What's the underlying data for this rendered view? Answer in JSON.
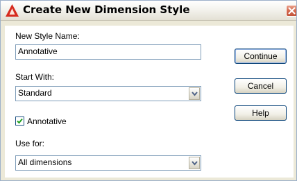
{
  "window": {
    "title": "Create New Dimension Style",
    "app_icon": "autocad-triangle-icon",
    "close_icon": "close-x-icon",
    "colors": {
      "title_icon": "#d62b1e",
      "close_button": "#d46a4f",
      "checkmark": "#21a121",
      "text": "#000000"
    }
  },
  "form": {
    "new_style_name": {
      "label": "New Style Name:",
      "value": "Annotative"
    },
    "start_with": {
      "label": "Start With:",
      "value": "Standard"
    },
    "annotative": {
      "label": "Annotative",
      "checked": true
    },
    "use_for": {
      "label": "Use for:",
      "value": "All dimensions"
    }
  },
  "buttons": {
    "continue": "Continue",
    "cancel": "Cancel",
    "help": "Help"
  }
}
